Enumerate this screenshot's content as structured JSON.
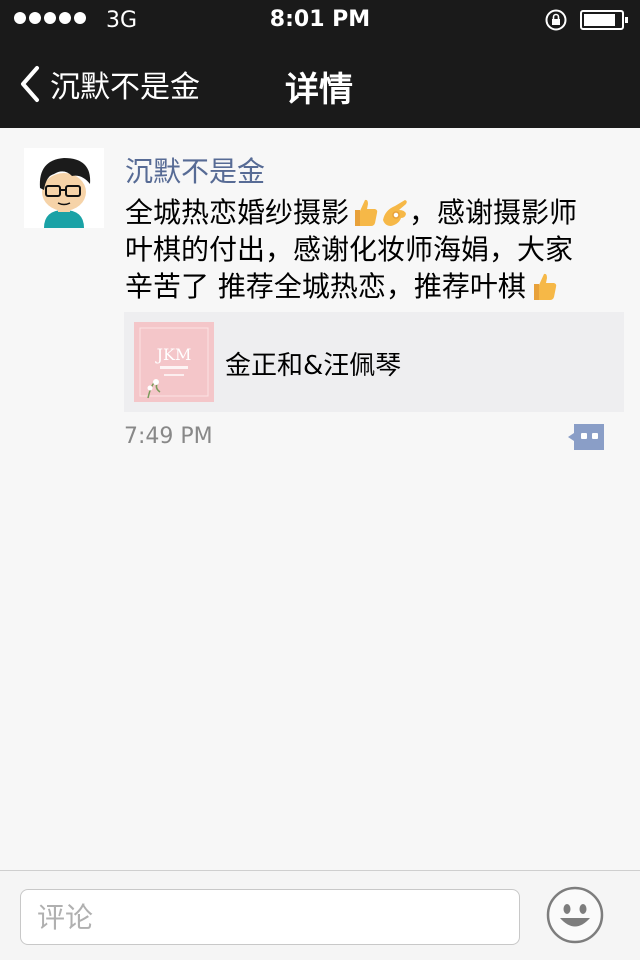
{
  "status_bar": {
    "carrier": "3G",
    "time": "8:01 PM",
    "signal_bars": 5,
    "battery_level": 0.85
  },
  "nav": {
    "back_label": "沉默不是金",
    "title": "详情"
  },
  "post": {
    "author": "沉默不是金",
    "text_line1_a": "全城热恋婚纱摄影",
    "text_line1_b": "，感谢摄影师",
    "text_line2": "叶棋的付出，感谢化妆师海娟，大家",
    "text_line3": "辛苦了  推荐全城热恋，推荐叶棋",
    "emojis": [
      "thumbs-up",
      "ok-hand",
      "thumbs-up"
    ],
    "link": {
      "title": "金正和&汪佩琴",
      "thumbnail_logo": "JKM"
    },
    "time": "7:49 PM"
  },
  "comment_bar": {
    "placeholder": "评论"
  },
  "colors": {
    "bar_bg": "#1a1a1a",
    "author_link": "#576b95",
    "page_bg": "#f7f7f7",
    "card_bg": "#eeeef0",
    "comment_icon": "#8a9ec7"
  }
}
